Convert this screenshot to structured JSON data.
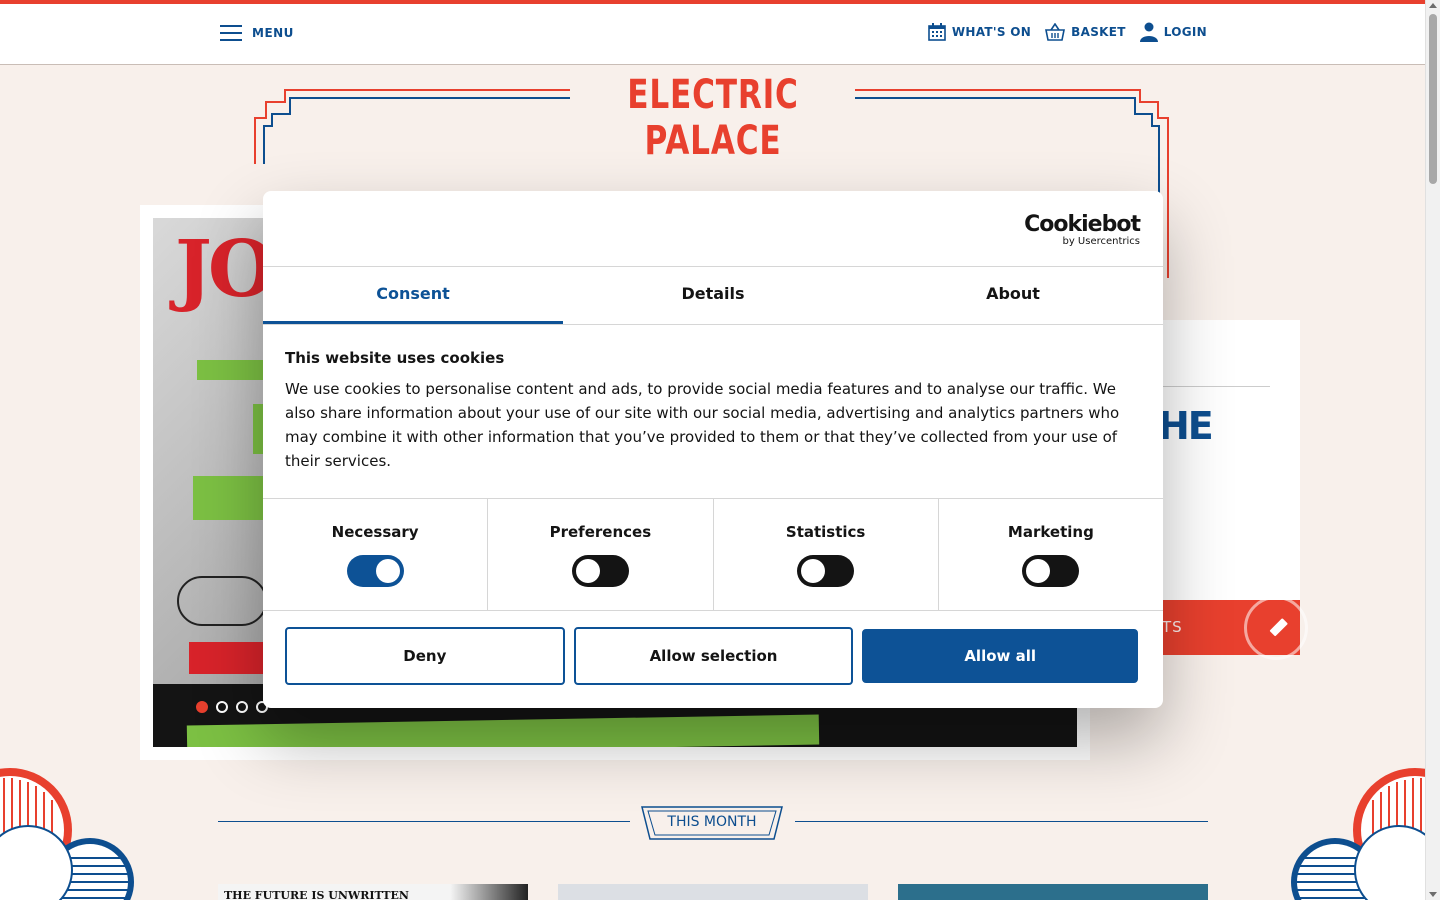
{
  "nav": {
    "menu_label": "MENU",
    "whats_on": "WHAT'S ON",
    "basket": "BASKET",
    "login": "LOGIN"
  },
  "brand": {
    "title": "ELECTRIC PALACE"
  },
  "hero": {
    "slide_count": 4,
    "active_slide": 1
  },
  "side_panel": {
    "heading_partial": "HE",
    "ticket_partial": "TS"
  },
  "section": {
    "this_month": "THIS MONTH"
  },
  "thumbnails": {
    "first_title": "THE FUTURE IS UNWRITTEN"
  },
  "cookie": {
    "logo_name": "Cookiebot",
    "logo_by": "by Usercentrics",
    "tabs": [
      "Consent",
      "Details",
      "About"
    ],
    "active_tab": "Consent",
    "title": "This website uses cookies",
    "text": "We use cookies to personalise content and ads, to provide social media features and to analyse our traffic. We also share information about your use of our site with our social media, advertising and analytics partners who may combine it with other information that you’ve provided to them or that they’ve collected from your use of their services.",
    "toggles": [
      {
        "label": "Necessary",
        "on": true
      },
      {
        "label": "Preferences",
        "on": false
      },
      {
        "label": "Statistics",
        "on": false
      },
      {
        "label": "Marketing",
        "on": false
      }
    ],
    "buttons": {
      "deny": "Deny",
      "allow_selection": "Allow selection",
      "allow_all": "Allow all"
    }
  },
  "colors": {
    "brand_red": "#e8402e",
    "brand_blue": "#0d4e8f",
    "cookie_blue": "#0d5296",
    "page_bg": "#f8f0eb"
  }
}
